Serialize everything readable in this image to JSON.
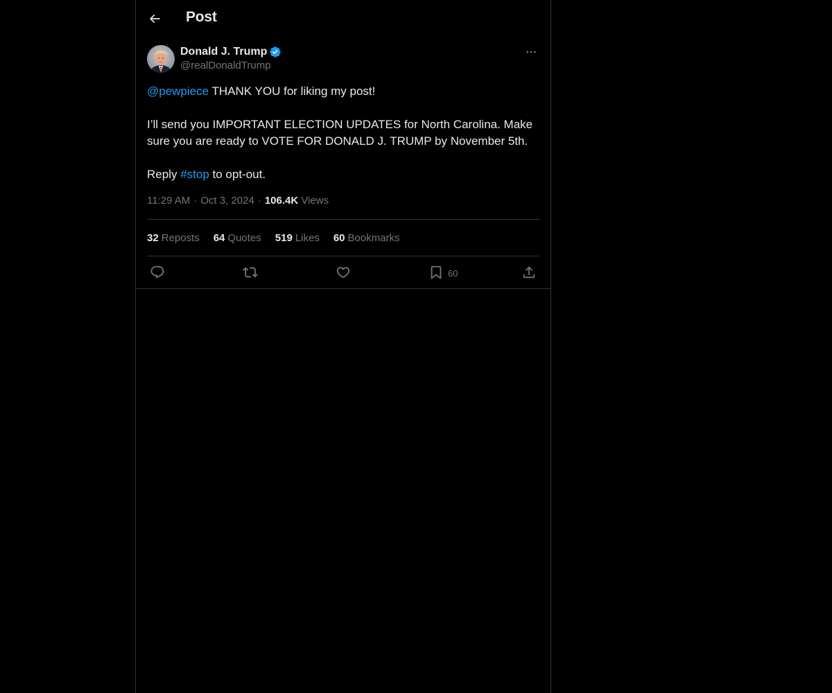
{
  "header": {
    "back_icon": "arrow-left-icon",
    "title": "Post"
  },
  "author": {
    "display_name": "Donald J. Trump",
    "handle": "@realDonaldTrump",
    "verified_icon": "verified-badge-icon",
    "verified_color": "#1d9bf0"
  },
  "post": {
    "mention": "@pewpiece",
    "line1_rest": " THANK YOU for liking my post!",
    "paragraph2": "I’ll send you IMPORTANT ELECTION UPDATES for North Carolina. Make sure you are ready to VOTE FOR DONALD J. TRUMP by November 5th.",
    "reply_prefix": "Reply ",
    "hashtag": "#stop",
    "reply_suffix": " to opt-out."
  },
  "meta": {
    "time": "11:29 AM",
    "separator": "·",
    "date": "Oct 3, 2024",
    "views_count": "106.4K",
    "views_label": "Views"
  },
  "stats": [
    {
      "count": "32",
      "label": "Reposts"
    },
    {
      "count": "64",
      "label": "Quotes"
    },
    {
      "count": "519",
      "label": "Likes"
    },
    {
      "count": "60",
      "label": "Bookmarks"
    }
  ],
  "actions": {
    "reply_icon": "reply-icon",
    "repost_icon": "repost-icon",
    "like_icon": "heart-icon",
    "bookmark_icon": "bookmark-icon",
    "bookmark_count": "60",
    "share_icon": "share-icon"
  },
  "colors": {
    "background": "#000000",
    "text": "#e7e9ea",
    "secondary": "#71767b",
    "accent": "#1d9bf0",
    "border": "#2f3336"
  }
}
